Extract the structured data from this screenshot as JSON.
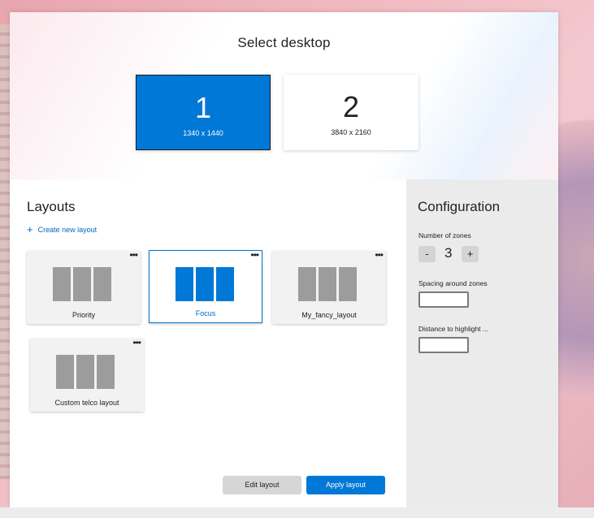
{
  "desktop": {
    "title": "Select desktop",
    "monitors": [
      {
        "number": "1",
        "resolution": "1340 x 1440",
        "selected": true
      },
      {
        "number": "2",
        "resolution": "3840 x 2160",
        "selected": false
      }
    ]
  },
  "layouts": {
    "title": "Layouts",
    "create_label": "Create new layout",
    "create_icon": "+",
    "more_icon": "•••",
    "items": [
      {
        "label": "Priority",
        "active": false
      },
      {
        "label": "Focus",
        "active": true
      },
      {
        "label": "My_fancy_layout",
        "active": false
      },
      {
        "label": "Custom telco layout",
        "active": false
      }
    ]
  },
  "configuration": {
    "title": "Configuration",
    "zones_label": "Number of zones",
    "zones_value": "3",
    "decrement": "-",
    "increment": "+",
    "spacing_label": "Spacing around zones",
    "spacing_value": "",
    "distance_label": "Distance to highlight ...",
    "distance_value": ""
  },
  "actions": {
    "edit_label": "Edit layout",
    "apply_label": "Apply layout"
  },
  "colors": {
    "accent": "#0078d7",
    "zone_gray": "#9c9c9c",
    "panel_gray": "#ebebeb"
  }
}
